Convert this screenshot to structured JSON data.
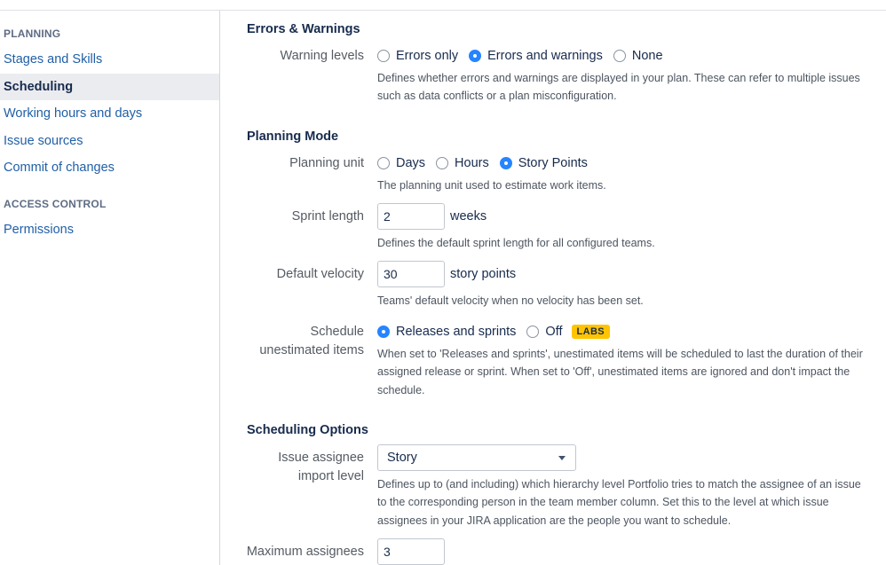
{
  "sidebar": {
    "planning_heading": "PLANNING",
    "planning_items": [
      {
        "label": "Stages and Skills"
      },
      {
        "label": "Scheduling"
      },
      {
        "label": "Working hours and days"
      },
      {
        "label": "Issue sources"
      },
      {
        "label": "Commit of changes"
      }
    ],
    "active_item": "Scheduling",
    "access_heading": "ACCESS CONTROL",
    "access_items": [
      {
        "label": "Permissions"
      }
    ]
  },
  "errors_warnings": {
    "title": "Errors & Warnings",
    "warning_levels": {
      "label": "Warning levels",
      "options": [
        "Errors only",
        "Errors and warnings",
        "None"
      ],
      "selected": "Errors and warnings",
      "description_line1": "Defines whether errors and warnings are displayed in your plan. These can refer to multiple issues",
      "description_line2": "such as data conflicts or a plan misconfiguration."
    }
  },
  "planning_mode": {
    "title": "Planning Mode",
    "planning_unit": {
      "label": "Planning unit",
      "options": [
        "Days",
        "Hours",
        "Story Points"
      ],
      "selected": "Story Points",
      "description": "The planning unit used to estimate work items."
    },
    "sprint_length": {
      "label": "Sprint length",
      "value": "2",
      "unit": "weeks",
      "description": "Defines the default sprint length for all configured teams."
    },
    "default_velocity": {
      "label": "Default velocity",
      "value": "30",
      "unit": "story points",
      "description": "Teams' default velocity when no velocity has been set."
    },
    "schedule_unestimated": {
      "label_line1": "Schedule",
      "label_line2": "unestimated items",
      "options": [
        "Releases and sprints",
        "Off"
      ],
      "selected": "Releases and sprints",
      "badge": "LABS",
      "description_line1": "When set to 'Releases and sprints', unestimated items will be scheduled to last the duration of their",
      "description_line2": "assigned release or sprint. When set to 'Off', unestimated items are ignored and don't impact the",
      "description_line3": "schedule."
    }
  },
  "scheduling_options": {
    "title": "Scheduling Options",
    "issue_assignee": {
      "label_line1": "Issue assignee",
      "label_line2": "import level",
      "selected": "Story",
      "description_line1": "Defines up to (and including) which hierarchy level Portfolio tries to match the assignee of an issue",
      "description_line2": "to the corresponding person in the team member column. Set this to the level at which issue",
      "description_line3": "assignees in your JIRA application are the people you want to schedule."
    },
    "maximum_assignees": {
      "label": "Maximum assignees",
      "value": "3"
    }
  },
  "colors": {
    "link": "#205fa6",
    "radio_checked": "#2684ff",
    "labs_badge": "#ffc400",
    "active_nav_bg": "#ebecf0"
  }
}
